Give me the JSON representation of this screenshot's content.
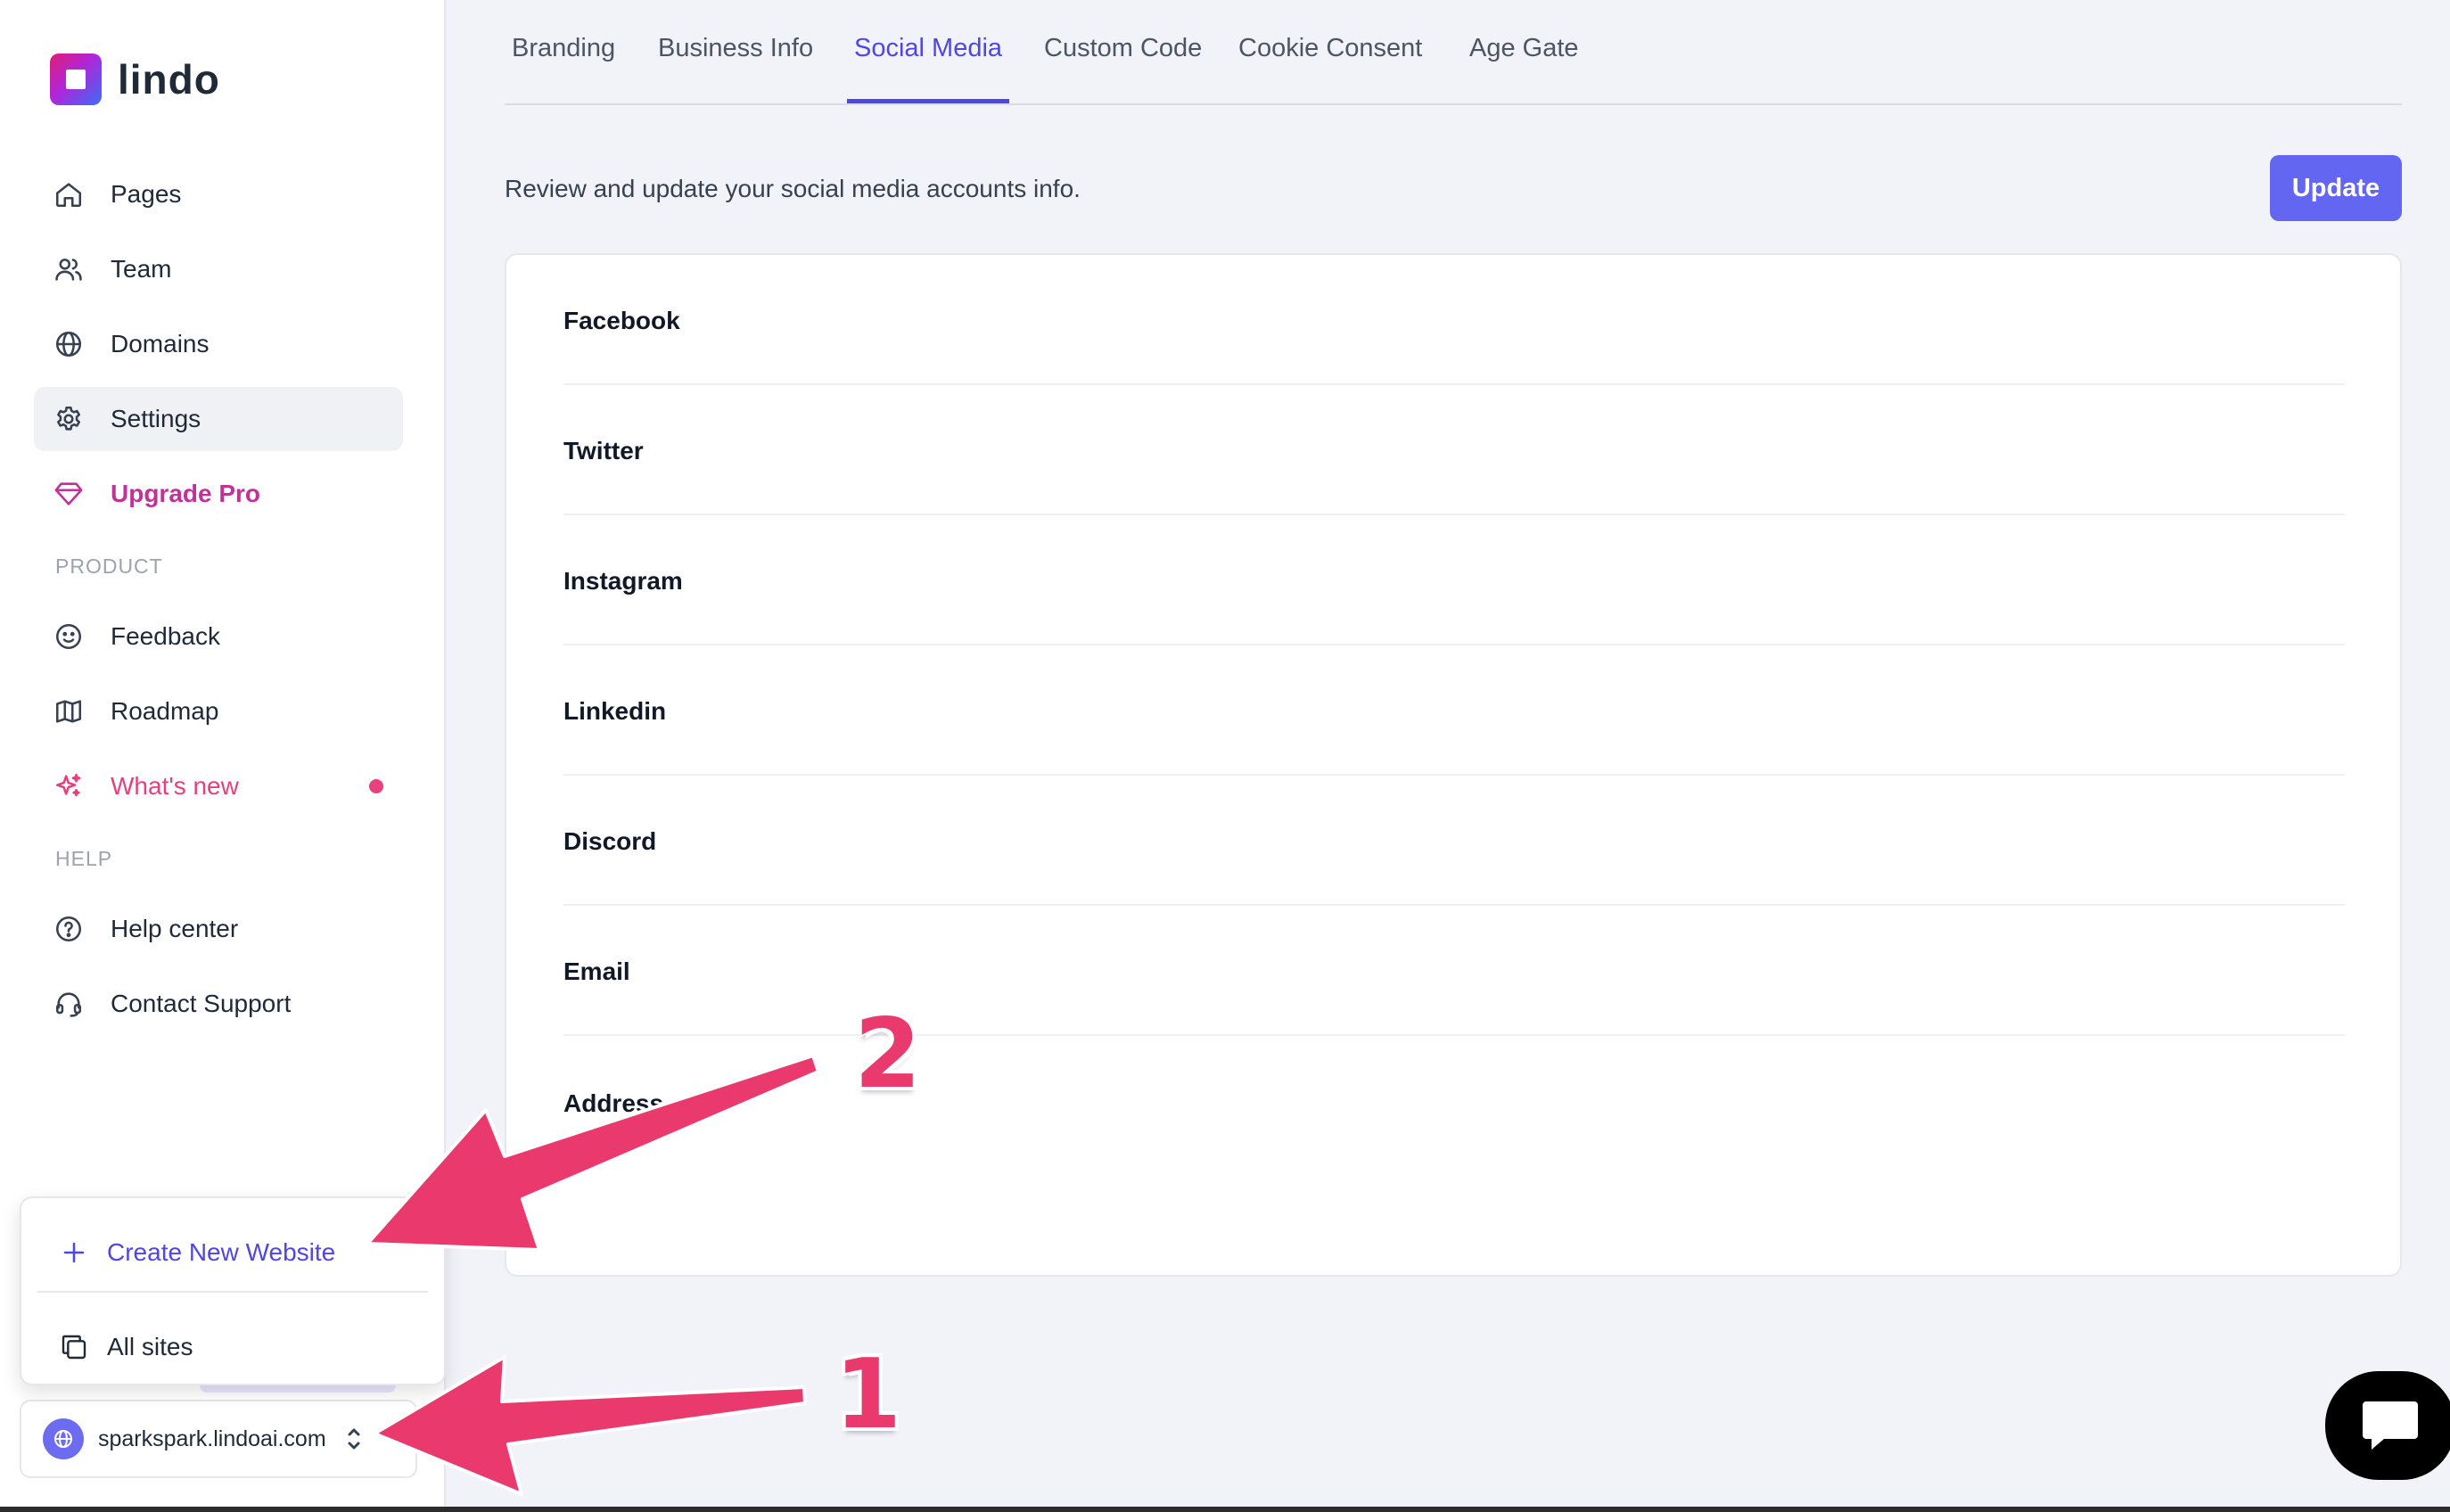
{
  "brand": {
    "name": "lindo"
  },
  "sidebar": {
    "items": [
      {
        "label": "Pages",
        "icon": "home-icon"
      },
      {
        "label": "Team",
        "icon": "users-icon"
      },
      {
        "label": "Domains",
        "icon": "globe-icon"
      },
      {
        "label": "Settings",
        "icon": "gear-icon",
        "active": true
      },
      {
        "label": "Upgrade Pro",
        "icon": "diamond-icon"
      }
    ],
    "product_label": "PRODUCT",
    "product_items": [
      {
        "label": "Feedback",
        "icon": "smile-icon"
      },
      {
        "label": "Roadmap",
        "icon": "map-icon"
      },
      {
        "label": "What's new",
        "icon": "sparkles-icon"
      }
    ],
    "help_label": "HELP",
    "help_items": [
      {
        "label": "Help center",
        "icon": "question-circle-icon"
      },
      {
        "label": "Contact Support",
        "icon": "headset-icon"
      }
    ],
    "popup": {
      "create_label": "Create New Website",
      "all_sites_label": "All sites"
    },
    "site_switcher": {
      "domain": "sparkspark.lindoai.com"
    }
  },
  "tabs": [
    "Branding",
    "Business Info",
    "Social Media",
    "Custom Code",
    "Cookie Consent",
    "Age Gate"
  ],
  "active_tab": "Social Media",
  "main": {
    "description": "Review and update your social media accounts info.",
    "update_label": "Update",
    "fields": [
      "Facebook",
      "Twitter",
      "Instagram",
      "Linkedin",
      "Discord",
      "Email",
      "Address"
    ]
  },
  "annotations": {
    "step1": "1",
    "step2": "2"
  },
  "colors": {
    "accent": "#6366f1",
    "arrow": "#ea3a6d",
    "upgrade": "#c2309a",
    "whatsnew": "#e5407d"
  }
}
